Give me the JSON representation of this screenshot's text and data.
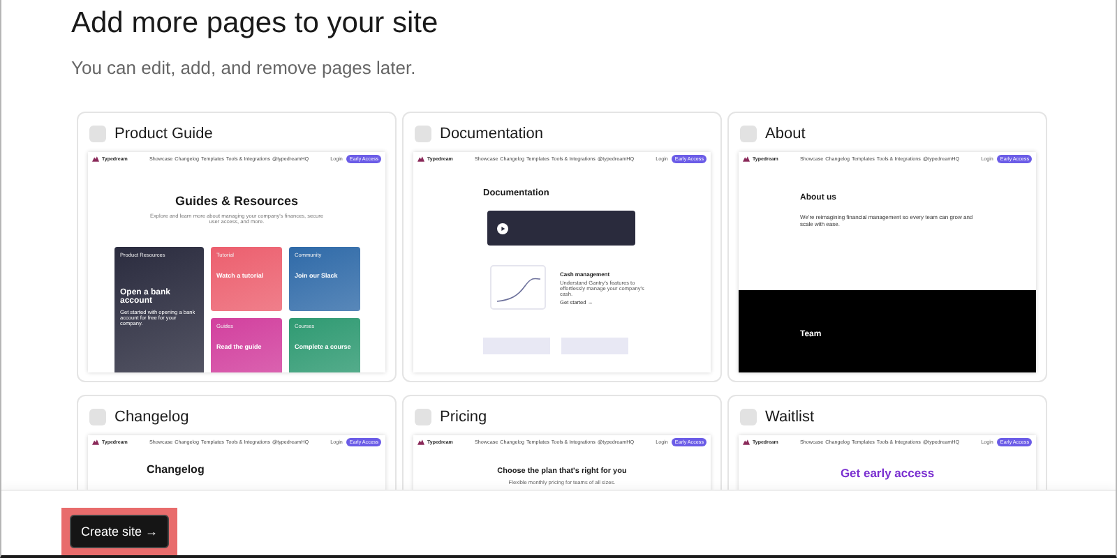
{
  "title": "Add more pages to your site",
  "subtitle": "You can edit, add, and remove pages later.",
  "pages": [
    {
      "name": "Product Guide",
      "checked": false,
      "preview": {
        "kind": "guides",
        "nav": {
          "brand": "Typedream",
          "links": [
            "Showcase",
            "Changelog",
            "Templates",
            "Tools & Integrations",
            "@typedreamHQ"
          ],
          "login": "Login",
          "cta": "Early Access"
        },
        "heading": "Guides & Resources",
        "intro": "Explore and learn more about managing your company's finances, secure user access, and more.",
        "tiles": [
          {
            "tag": "Product Resources",
            "title": "Open a bank account",
            "text": "Get started with opening a bank account for free for your company.",
            "color": "#2b2c3f"
          },
          {
            "tag": "Tutorial",
            "title": "Watch a tutorial",
            "color": "#ec5f6e"
          },
          {
            "tag": "Community",
            "title": "Join our Slack",
            "color": "#2f6aa8"
          },
          {
            "tag": "Guides",
            "title": "Read the guide",
            "color": "#d2409e"
          },
          {
            "tag": "Courses",
            "title": "Complete a course",
            "color": "#2f9a72"
          }
        ]
      }
    },
    {
      "name": "Documentation",
      "checked": false,
      "preview": {
        "kind": "docs",
        "nav": {
          "brand": "Typedream",
          "links": [
            "Showcase",
            "Changelog",
            "Templates",
            "Tools & Integrations",
            "@typedreamHQ"
          ],
          "login": "Login",
          "cta": "Early Access"
        },
        "heading": "Documentation",
        "feature": "Cash management",
        "feature_text": "Understand Gantry's features to effortlessly manage your company's cash.",
        "feature_link": "Get started →"
      }
    },
    {
      "name": "About",
      "checked": false,
      "preview": {
        "kind": "about",
        "nav": {
          "brand": "Typedream",
          "links": [
            "Showcase",
            "Changelog",
            "Templates",
            "Tools & Integrations",
            "@typedreamHQ"
          ],
          "login": "Login",
          "cta": "Early Access"
        },
        "heading": "About us",
        "lead": "We're reimagining financial management so every team can grow and scale with ease.",
        "team": "Team"
      }
    },
    {
      "name": "Changelog",
      "checked": false,
      "preview": {
        "kind": "changelog",
        "nav": {
          "brand": "Typedream",
          "links": [
            "Showcase",
            "Changelog",
            "Templates",
            "Tools & Integrations",
            "@typedreamHQ"
          ],
          "login": "Login",
          "cta": "Early Access"
        },
        "heading": "Changelog"
      }
    },
    {
      "name": "Pricing",
      "checked": false,
      "preview": {
        "kind": "pricing",
        "nav": {
          "brand": "Typedream",
          "links": [
            "Showcase",
            "Changelog",
            "Templates",
            "Tools & Integrations",
            "@typedreamHQ"
          ],
          "login": "Login",
          "cta": "Early Access"
        },
        "heading": "Choose the plan that's right for you",
        "sub": "Flexible monthly pricing for teams of all sizes."
      }
    },
    {
      "name": "Waitlist",
      "checked": false,
      "preview": {
        "kind": "waitlist",
        "nav": {
          "brand": "Typedream",
          "links": [
            "Showcase",
            "Changelog",
            "Templates",
            "Tools & Integrations",
            "@typedreamHQ"
          ],
          "login": "Login",
          "cta": "Early Access"
        },
        "heading": "Get early access"
      }
    }
  ],
  "button": "Create site →"
}
